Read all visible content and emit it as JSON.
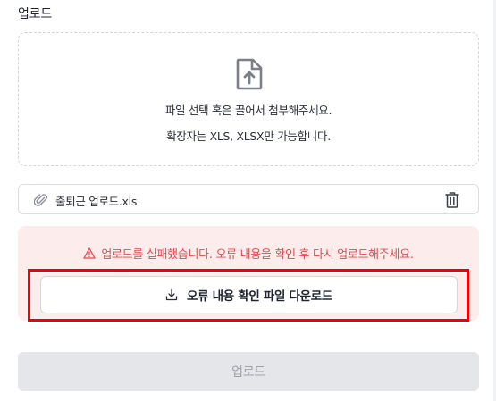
{
  "section": {
    "title": "업로드"
  },
  "dropzone": {
    "icon": "file-upload-icon",
    "line1": "파일 선택 혹은 끌어서 첨부해주세요.",
    "line2": "확장자는 XLS, XLSX만 가능합니다."
  },
  "file": {
    "icon": "paperclip-icon",
    "name": "출퇴근 업로드.xls",
    "delete_icon": "trash-icon"
  },
  "error": {
    "icon": "warning-triangle-icon",
    "message": "업로드를 실패했습니다. 오류 내용을 확인 후 다시 업로드해주세요.",
    "color": "#e5484d",
    "background": "#fdecec"
  },
  "download_button": {
    "icon": "download-icon",
    "label": "오류 내용 확인 파일 다운로드"
  },
  "upload_button": {
    "label": "업로드",
    "state": "disabled"
  },
  "highlight_color": "#f00000"
}
